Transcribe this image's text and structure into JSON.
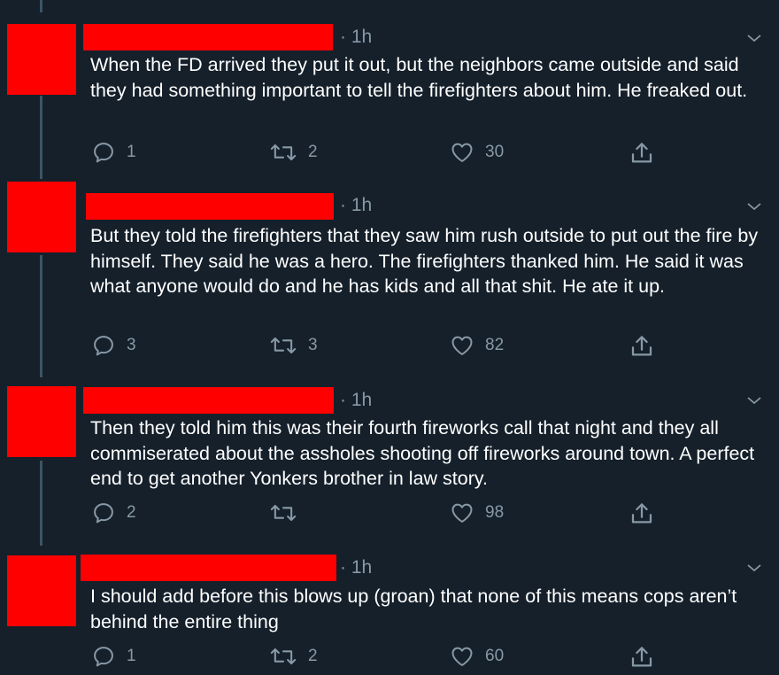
{
  "tweets": [
    {
      "time": "· 1h",
      "text": "When the FD arrived they put it out, but the neighbors came outside and said they had something important to tell the firefighters about him. He freaked out.",
      "replies": "1",
      "retweets": "2",
      "likes": "30"
    },
    {
      "time": "· 1h",
      "text": "But they told the firefighters that they saw him rush outside to put out the fire by himself. They said he was a hero. The firefighters thanked him. He said it was what anyone would do and he has kids and all that shit. He ate it up.",
      "replies": "3",
      "retweets": "3",
      "likes": "82"
    },
    {
      "time": "· 1h",
      "text": "Then they told him this was their fourth fireworks call that night and they all commiserated about the assholes shooting off fireworks around town. A perfect end to get another Yonkers brother in law story.",
      "replies": "2",
      "retweets": "",
      "likes": "98"
    },
    {
      "time": "· 1h",
      "text": "I should add before this blows up (groan) that none of this means cops aren’t behind the entire thing",
      "replies": "1",
      "retweets": "2",
      "likes": "60"
    }
  ],
  "icons": {
    "reply": "reply-icon",
    "retweet": "retweet-icon",
    "like": "heart-icon",
    "share": "share-icon",
    "more": "chevron-down-icon"
  },
  "colors": {
    "background": "#15202b",
    "redaction": "#ff0000",
    "muted_text": "#8899a6",
    "thread_line": "#3d5466"
  }
}
